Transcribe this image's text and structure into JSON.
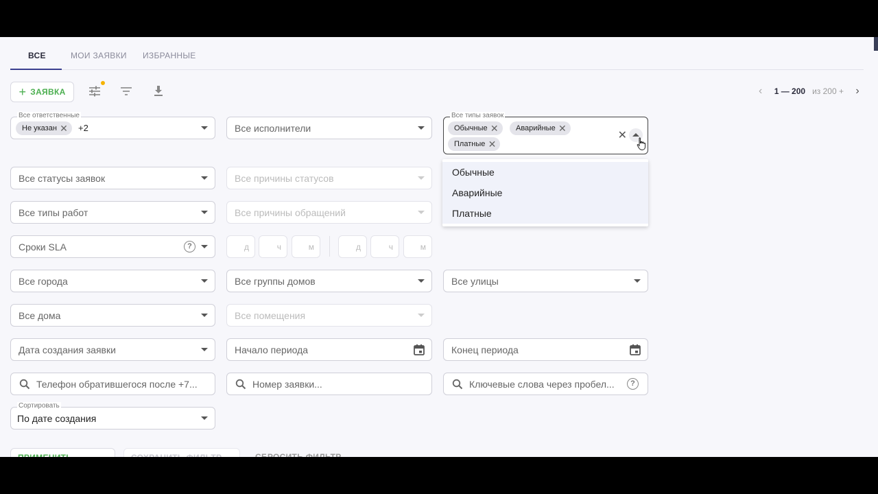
{
  "tabs": [
    {
      "label": "Все",
      "active": true
    },
    {
      "label": "Мои заявки"
    },
    {
      "label": "Избранные"
    }
  ],
  "toolbar": {
    "add_label": "ЗАЯВКА",
    "icons": [
      "tune-icon",
      "filter-icon",
      "download-icon"
    ]
  },
  "pager": {
    "range": "1 — 200",
    "total": "из 200 +"
  },
  "filters": {
    "responsible": {
      "label": "Все ответственные",
      "chip": "Не указан",
      "more": "+2"
    },
    "executors": {
      "placeholder": "Все исполнители"
    },
    "request_types": {
      "label": "Все типы заявок",
      "chips": [
        "Обычные",
        "Аварийные",
        "Платные"
      ],
      "options": [
        "Обычные",
        "Аварийные",
        "Платные"
      ]
    },
    "statuses": {
      "placeholder": "Все статусы заявок"
    },
    "status_reasons": {
      "placeholder": "Все причины статусов"
    },
    "work_types": {
      "placeholder": "Все типы работ"
    },
    "appeal_reasons": {
      "placeholder": "Все причины обращений"
    },
    "sla": {
      "placeholder": "Сроки SLA",
      "units": [
        "д",
        "ч",
        "м",
        "д",
        "ч",
        "м"
      ]
    },
    "cities": {
      "placeholder": "Все города"
    },
    "house_groups": {
      "placeholder": "Все группы домов"
    },
    "streets": {
      "placeholder": "Все улицы"
    },
    "houses": {
      "placeholder": "Все дома"
    },
    "premises": {
      "placeholder": "Все помещения"
    },
    "created_date": {
      "placeholder": "Дата создания заявки"
    },
    "period_start": {
      "placeholder": "Начало периода"
    },
    "period_end": {
      "placeholder": "Конец периода"
    },
    "phone": {
      "placeholder": "Телефон обратившегося после +7..."
    },
    "number": {
      "placeholder": "Номер заявки..."
    },
    "keywords": {
      "placeholder": "Ключевые слова через пробел..."
    },
    "sort": {
      "label": "Сортировать",
      "value": "По дате создания"
    }
  },
  "actions": {
    "apply": "Применить фильтр",
    "save": "Сохранить фильтр",
    "reset": "Сбросить фильтр"
  }
}
